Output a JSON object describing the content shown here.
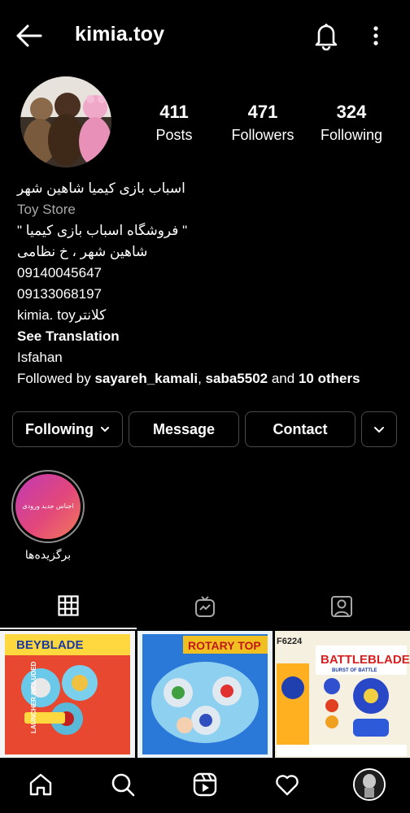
{
  "header": {
    "username": "kimia.toy",
    "back_icon": "arrow-left-icon",
    "notification_icon": "bell-icon",
    "more_icon": "more-vertical-icon"
  },
  "profile": {
    "avatar_icon": "teddy-bears-avatar",
    "stats": {
      "posts_count": "411",
      "posts_label": "Posts",
      "followers_count": "471",
      "followers_label": "Followers",
      "following_count": "324",
      "following_label": "Following"
    },
    "bio": {
      "name": "اسباب بازی کیمیا شاهین شهر",
      "category": "Toy Store",
      "line1": "\" فروشگاه اسباب بازی کیمیا \"",
      "line2": "شاهین شهر ، خ نظامی",
      "phone1": "09140045647",
      "phone2": "09133068197",
      "line3": "کلانترkimia. toy",
      "see_translation": "See Translation",
      "location": "Isfahan",
      "followed_by_prefix": "Followed by ",
      "followed_by_user1": "sayareh_kamali",
      "followed_by_sep": ", ",
      "followed_by_user2": "saba5502",
      "followed_by_and": " and ",
      "followed_by_others": "10 others"
    }
  },
  "actions": {
    "following_label": "Following",
    "message_label": "Message",
    "contact_label": "Contact"
  },
  "highlights": [
    {
      "cover_text": "اجناس جدید ورودی",
      "label": "برگزیده‌ها"
    }
  ],
  "tabs": [
    {
      "name": "grid",
      "icon": "grid-icon",
      "active": true
    },
    {
      "name": "reels",
      "icon": "reels-tv-icon",
      "active": false
    },
    {
      "name": "tagged",
      "icon": "tagged-person-icon",
      "active": false
    }
  ],
  "posts": [
    {
      "title": "BEYBLADE",
      "sub": "LAUNCHER INCLUDED"
    },
    {
      "title": "ROTARY TOP",
      "sub": ""
    },
    {
      "title": "BATTLEBLADE",
      "sub": "BURST OF BATTLE",
      "code": "F6224"
    }
  ],
  "bottom_nav": [
    "home-icon",
    "search-icon",
    "reels-icon",
    "heart-icon",
    "profile-avatar"
  ],
  "colors": {
    "background": "#000000",
    "secondary_text": "#a8a8a8",
    "button_border": "#4a4a4a"
  }
}
